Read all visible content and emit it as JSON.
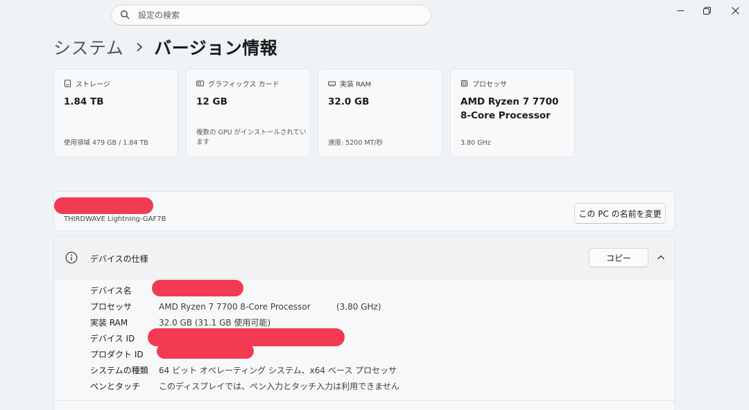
{
  "titlebar": {
    "search_placeholder": "設定の検索"
  },
  "breadcrumb": {
    "parent": "システム",
    "current": "バージョン情報"
  },
  "cards": [
    {
      "icon": "storage-icon",
      "label": "ストレージ",
      "value": "1.84 TB",
      "sub": "使用領域 479 GB / 1.84 TB"
    },
    {
      "icon": "graphics-card-icon",
      "label": "グラフィックス カード",
      "value": "12 GB",
      "sub": "複数の GPU がインストールされています"
    },
    {
      "icon": "ram-icon",
      "label": "実装 RAM",
      "value": "32.0 GB",
      "sub": "速度: 5200 MT/秒"
    },
    {
      "icon": "processor-icon",
      "label": "プロセッサ",
      "value": "AMD Ryzen 7 7700 8-Core Processor",
      "sub": "3.80 GHz"
    }
  ],
  "device": {
    "model": "THIRDWAVE Lightning-GAF7B",
    "rename_button": "この PC の名前を変更"
  },
  "spec": {
    "title": "デバイスの仕様",
    "copy_button": "コピー",
    "rows": [
      {
        "key": "デバイス名",
        "value": "",
        "extra": ""
      },
      {
        "key": "プロセッサ",
        "value": "AMD Ryzen 7 7700 8-Core Processor",
        "extra": "(3.80 GHz)"
      },
      {
        "key": "実装 RAM",
        "value": "32.0 GB (31.1 GB 使用可能)",
        "extra": ""
      },
      {
        "key": "デバイス ID",
        "value": "",
        "extra": ""
      },
      {
        "key": "プロダクト ID",
        "value": "",
        "extra": ""
      },
      {
        "key": "システムの種類",
        "value": "64 ビット オペレーティング システム、x64 ベース プロセッサ",
        "extra": ""
      },
      {
        "key": "ペンとタッチ",
        "value": "このディスプレイでは、ペン入力とタッチ入力は利用できません",
        "extra": ""
      }
    ]
  },
  "colors": {
    "redaction": "#f23a52",
    "background": "#f0f3f5"
  }
}
